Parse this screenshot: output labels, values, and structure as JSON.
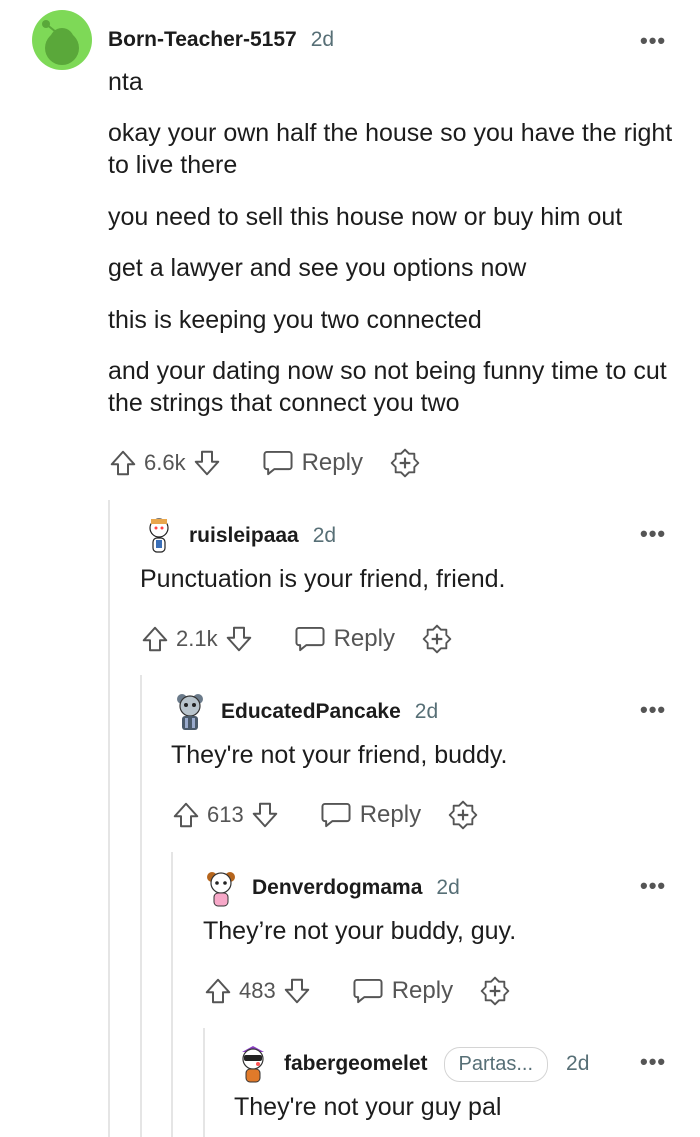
{
  "comments": [
    {
      "username": "Born-Teacher-5157",
      "time": "2d",
      "more": "•••",
      "paragraphs": [
        "nta",
        "okay your own half the house so you have the right to live there",
        "you need to sell this house now or buy him out",
        "get a lawyer and see you options now",
        "this is keeping you two connected",
        "and your dating now so not being funny time to cut the strings that connect you two"
      ],
      "score": "6.6k",
      "reply_label": "Reply"
    },
    {
      "username": "ruisleipaaa",
      "time": "2d",
      "more": "•••",
      "text": "Punctuation is your friend, friend.",
      "score": "2.1k",
      "reply_label": "Reply"
    },
    {
      "username": "EducatedPancake",
      "time": "2d",
      "more": "•••",
      "text": "They're not your friend, buddy.",
      "score": "613",
      "reply_label": "Reply"
    },
    {
      "username": "Denverdogmama",
      "time": "2d",
      "more": "•••",
      "text": "They’re not your buddy, guy.",
      "score": "483",
      "reply_label": "Reply"
    },
    {
      "username": "fabergeomelet",
      "flair": "Partas...",
      "time": "2d",
      "more": "•••",
      "text": "They're not your guy pal"
    }
  ],
  "icons": {
    "upvote": "upvote-icon",
    "downvote": "downvote-icon",
    "reply": "comment-bubble-icon",
    "award": "award-plus-icon",
    "more": "more-options-icon"
  },
  "colors": {
    "avatar_green": "#7ed957",
    "text_primary": "#1c1c1c",
    "text_secondary": "#576f76",
    "thread_line": "#e5e5e5"
  }
}
